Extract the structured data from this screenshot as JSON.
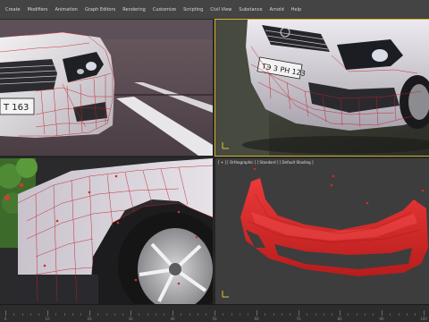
{
  "menubar": {
    "items": [
      "Create",
      "Modifiers",
      "Animation",
      "Graph Editors",
      "Rendering",
      "Customize",
      "Scripting",
      "Civil View",
      "Substance",
      "Arnold",
      "Help"
    ]
  },
  "viewports": {
    "top_left": {
      "content": "front bumper reference photo with wireframe overlay",
      "plate_text": "T 163"
    },
    "top_right": {
      "content": "bumper reference photo with wireframe overlay",
      "plate_text": "ТЭ 3 РН 123"
    },
    "bottom_left": {
      "content": "wheel arch reference photo with wireframe overlay"
    },
    "bottom_right": {
      "label": "[ + ] [ Orthographic ] [ Standard ] [ Default Shading ]",
      "content": "red bumper mesh"
    }
  },
  "timeline": {
    "labels": [
      "0",
      "10",
      "20",
      "30",
      "40",
      "50",
      "60",
      "70",
      "80",
      "90",
      "100"
    ]
  },
  "colors": {
    "menubar_bg": "#444444",
    "viewport_border_active": "#d8b030",
    "mesh_red": "#d42a2a",
    "wire_red": "#c0202a"
  },
  "icons": {
    "axis_gizmo": "axis-gizmo-icon"
  }
}
